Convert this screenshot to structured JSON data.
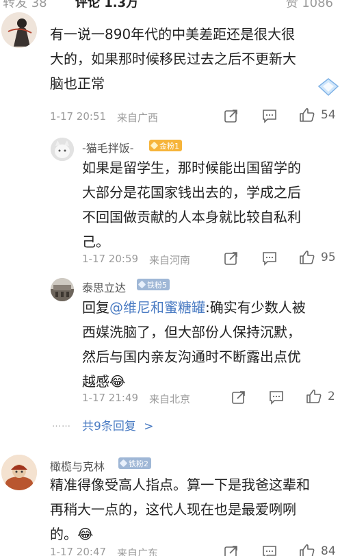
{
  "tabs": {
    "left": "转发 38",
    "middle": "评论 1.3万",
    "right": "赞 1086"
  },
  "comments": [
    {
      "text": "有一说一890年代的中美差距还是很大很大的，如果那时候移民过去之后不更新大脑也正常",
      "lines": [
        "有一说一890年代的中美差距还是很大很",
        "大的，如果那时候移民过去之后不更新大",
        "脑也正常"
      ],
      "time": "1-17 20:51",
      "location": "来自广西",
      "likes": "54"
    },
    {
      "username": "-猫毛拌饭-",
      "badge": "金粉1",
      "lines": [
        "如果是留学生，那时候能出国留学的",
        "大部分是花国家钱出去的，学成之后",
        "不回国做贡献的人本身就比较自私利",
        "己。"
      ],
      "time": "1-17 20:59",
      "location": "来自河南",
      "likes": "95"
    },
    {
      "username": "泰思立达",
      "badge": "铁粉5",
      "reply_prefix": "回复",
      "mention": "@维尼和蜜糖罐",
      "line1_rest": ":确实有少数人被",
      "lines": [
        "西媒洗脑了，但大部份人保持沉默，",
        "然后与国内亲友沟通时不断露出点优",
        "越感"
      ],
      "emoji": "😂",
      "time": "1-17 21:49",
      "location": "来自北京",
      "likes": "2"
    },
    {
      "username": "橄榄与克林",
      "badge": "铁粉2",
      "lines": [
        "精准得像受高人指点。算一下是我爸这辈和",
        "再稍大一点的，这代人现在也是最爱咧咧",
        "的。"
      ],
      "emoji": "😂",
      "time": "1-17 20:47",
      "location": "来自广东",
      "likes": "84"
    }
  ],
  "replies_link": {
    "dots": "……",
    "label": "共9条回复",
    "arrow": ">"
  },
  "icons": [
    "repost-icon",
    "comment-icon",
    "like-icon",
    "diamond-sticker-icon"
  ],
  "colors": {
    "link": "#4b7cc3",
    "meta": "#9a9a9a",
    "gold_badge": "#f6b43a",
    "iron_badge": "#9fb7d6"
  }
}
